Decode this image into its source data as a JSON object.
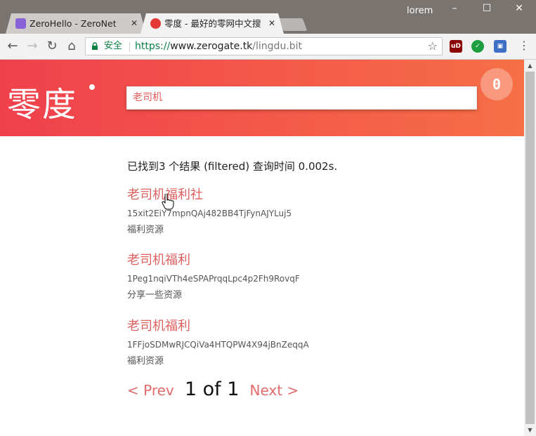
{
  "window": {
    "user": "lorem",
    "minimize": "–",
    "maximize": "☐",
    "close": "✕"
  },
  "tabs": [
    {
      "title": "ZeroHello - ZeroNet",
      "close": "✕",
      "favicon_color": "#8a62d8"
    },
    {
      "title": "零度 - 最好的零网中文搜",
      "close": "✕",
      "favicon_color": "#e53935"
    }
  ],
  "toolbar": {
    "back": "←",
    "forward": "→",
    "reload": "↻",
    "home": "⌂",
    "secure_label": "安全",
    "url_scheme": "https://",
    "url_host": "www.zerogate.tk",
    "url_path": "/lingdu.bit",
    "star": "☆",
    "menu": "⋮"
  },
  "header": {
    "logo": "零度",
    "search_value": "老司机",
    "peer_count": "0"
  },
  "results_meta": "已找到3 个结果 (filtered) 查询时间 0.002s.",
  "results": [
    {
      "title": "老司机福利社",
      "address": "15xit2EiY7mpnQAj482BB4TjFynAJYLuj5",
      "description": "福利资源"
    },
    {
      "title": "老司机福利",
      "address": "1Peg1nqiVTh4eSPAPrqqLpc4p2Fh9RovqF",
      "description": "分享一些资源"
    },
    {
      "title": "老司机福利",
      "address": "1FFjoSDMwRJCQiVa4HTQPW4X94jBnZeqqA",
      "description": "福利资源"
    }
  ],
  "pager": {
    "prev": "< Prev",
    "current": "1 of 1",
    "next": "Next >"
  },
  "colors": {
    "accent": "#e06060",
    "header_gradient_start": "#f0404c",
    "header_gradient_end": "#f66f46"
  }
}
